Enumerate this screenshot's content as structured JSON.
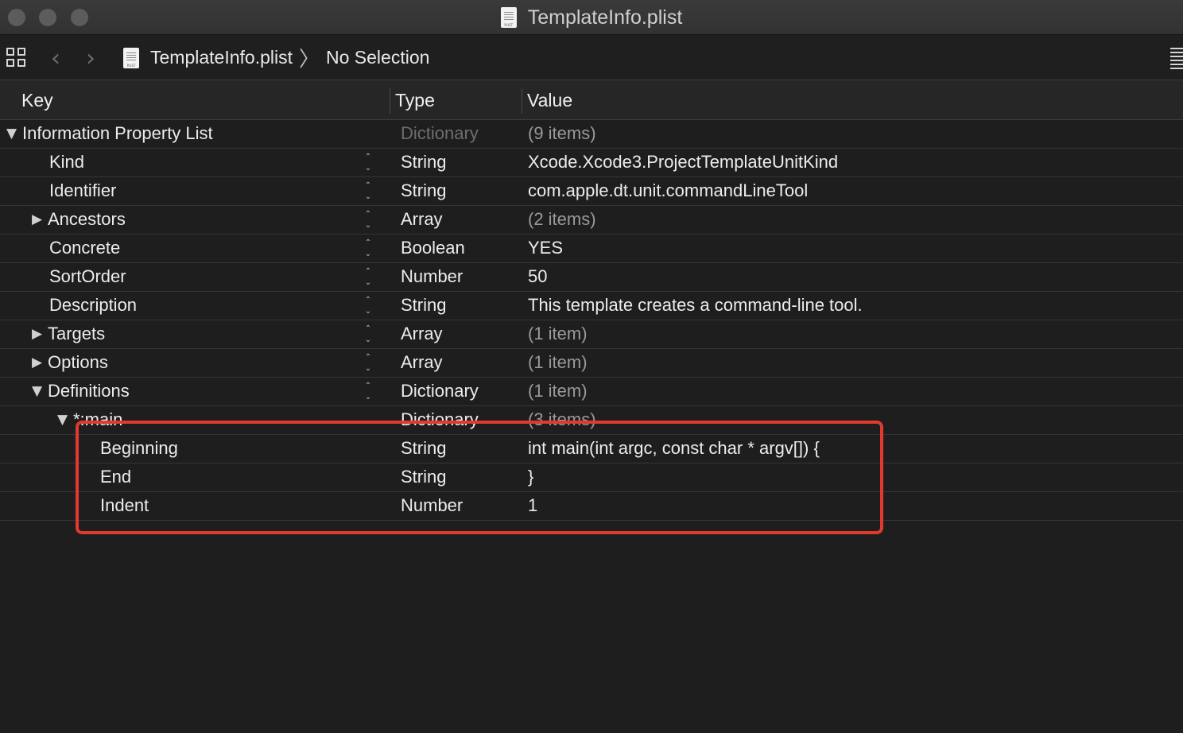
{
  "window": {
    "title": "TemplateInfo.plist"
  },
  "jumpbar": {
    "file": "TemplateInfo.plist",
    "selection": "No Selection",
    "separator": "〉"
  },
  "columns": {
    "key": "Key",
    "type": "Type",
    "value": "Value"
  },
  "icons": {
    "back": "‹",
    "forward": "›",
    "collapse": "▼",
    "expand": "▶",
    "up": "⌃",
    "down": "⌄"
  },
  "rows": [
    {
      "key": "Information Property List",
      "type": "Dictionary",
      "value": "(9 items)"
    },
    {
      "key": "Kind",
      "type": "String",
      "value": "Xcode.Xcode3.ProjectTemplateUnitKind"
    },
    {
      "key": "Identifier",
      "type": "String",
      "value": "com.apple.dt.unit.commandLineTool"
    },
    {
      "key": "Ancestors",
      "type": "Array",
      "value": "(2 items)"
    },
    {
      "key": "Concrete",
      "type": "Boolean",
      "value": "YES"
    },
    {
      "key": "SortOrder",
      "type": "Number",
      "value": "50"
    },
    {
      "key": "Description",
      "type": "String",
      "value": "This template creates a command-line tool."
    },
    {
      "key": "Targets",
      "type": "Array",
      "value": "(1 item)"
    },
    {
      "key": "Options",
      "type": "Array",
      "value": "(1 item)"
    },
    {
      "key": "Definitions",
      "type": "Dictionary",
      "value": "(1 item)"
    },
    {
      "key": "*:main",
      "type": "Dictionary",
      "value": "(3 items)"
    },
    {
      "key": "Beginning",
      "type": "String",
      "value": "int main(int argc, const char * argv[]) {"
    },
    {
      "key": "End",
      "type": "String",
      "value": "}"
    },
    {
      "key": "Indent",
      "type": "Number",
      "value": "1"
    }
  ],
  "colors": {
    "annotation": "#e03a2f",
    "background": "#1e1e1e"
  }
}
